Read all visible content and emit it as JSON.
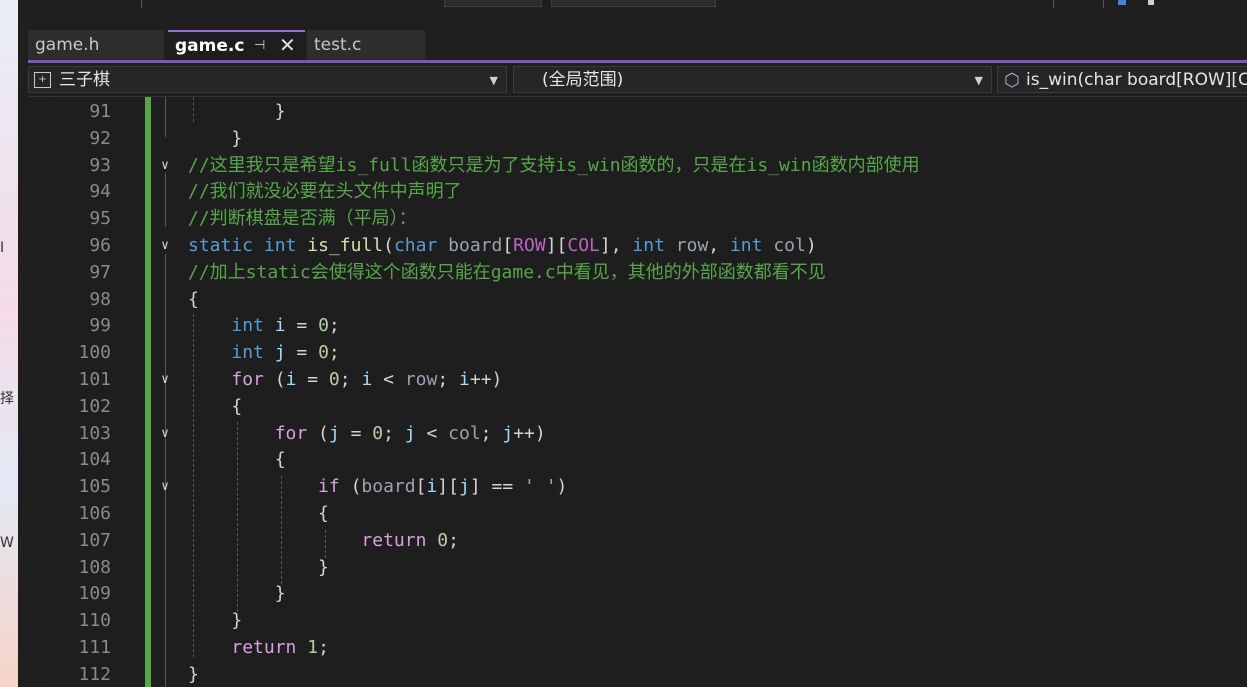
{
  "desktop": {
    "glyphs": [
      "I",
      "择",
      "W"
    ]
  },
  "tabs": [
    {
      "label": "game.h",
      "active": false
    },
    {
      "label": "game.c",
      "active": true
    },
    {
      "label": "test.c",
      "active": false
    }
  ],
  "nav": {
    "project": "三子棋",
    "scope": "(全局范围)",
    "member": "is_win(char board[ROW][C"
  },
  "editor": {
    "lines": [
      {
        "n": "91",
        "text": "        }"
      },
      {
        "n": "92",
        "text": "    }"
      },
      {
        "n": "93",
        "text": "//这里我只是希望is_full函数只是为了支持is_win函数的，只是在is_win函数内部使用"
      },
      {
        "n": "94",
        "text": "//我们就没必要在头文件中声明了"
      },
      {
        "n": "95",
        "text": "//判断棋盘是否满（平局）："
      },
      {
        "n": "96",
        "text": "static int is_full(char board[ROW][COL], int row, int col)"
      },
      {
        "n": "97",
        "text": "//加上static会使得这个函数只能在game.c中看见，其他的外部函数都看不见"
      },
      {
        "n": "98",
        "text": "{"
      },
      {
        "n": "99",
        "text": "    int i = 0;"
      },
      {
        "n": "100",
        "text": "    int j = 0;"
      },
      {
        "n": "101",
        "text": "    for (i = 0; i < row; i++)"
      },
      {
        "n": "102",
        "text": "    {"
      },
      {
        "n": "103",
        "text": "        for (j = 0; j < col; j++)"
      },
      {
        "n": "104",
        "text": "        {"
      },
      {
        "n": "105",
        "text": "            if (board[i][j] == ' ')"
      },
      {
        "n": "106",
        "text": "            {"
      },
      {
        "n": "107",
        "text": "                return 0;"
      },
      {
        "n": "108",
        "text": "            }"
      },
      {
        "n": "109",
        "text": "        }"
      },
      {
        "n": "110",
        "text": "    }"
      },
      {
        "n": "111",
        "text": "    return 1;"
      },
      {
        "n": "112",
        "text": "}"
      }
    ]
  },
  "colors": {
    "keyword": "#569cd6",
    "control": "#d8a0df",
    "comment": "#57a64a",
    "number": "#b5cea8",
    "function": "#dcdcaa",
    "macro": "#bd63c5",
    "accent": "#7a57c2",
    "change_bar": "#57a64a"
  }
}
